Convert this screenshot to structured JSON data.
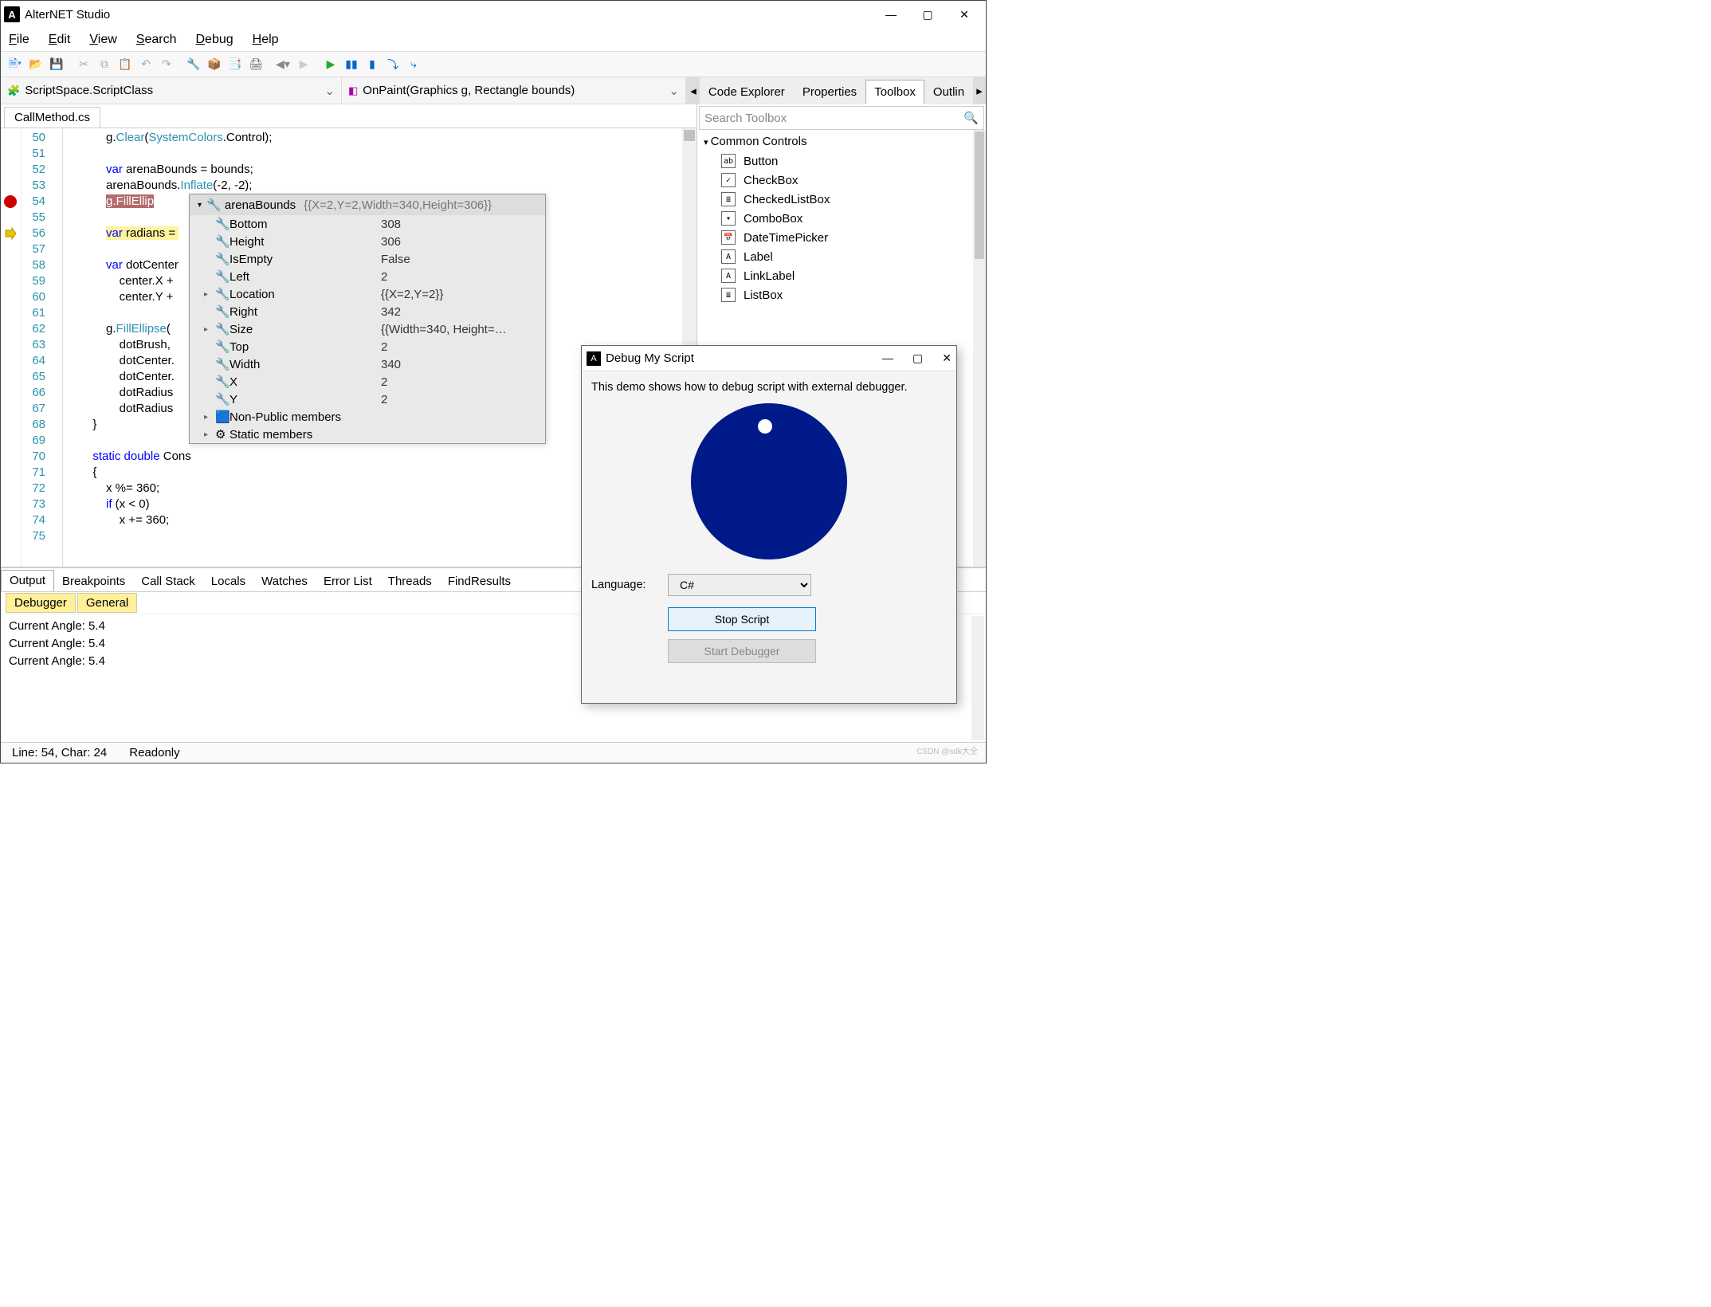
{
  "window": {
    "title": "AlterNET Studio"
  },
  "menu": [
    "File",
    "Edit",
    "View",
    "Search",
    "Debug",
    "Help"
  ],
  "context": {
    "left": "ScriptSpace.ScriptClass",
    "right": "OnPaint(Graphics  g, Rectangle  bounds)"
  },
  "right_tabs": [
    "Code Explorer",
    "Properties",
    "Toolbox",
    "Outlin"
  ],
  "right_tabs_active": 2,
  "file_tab": "CallMethod.cs",
  "editor": {
    "first_line": 50,
    "breakpoint_line": 54,
    "current_line": 56,
    "lines": [
      "            g.Clear(SystemColors.Control);",
      "",
      "            var arenaBounds = bounds;",
      "            arenaBounds.Inflate(-2, -2);",
      "            g.FillEllip",
      "",
      "            var radians = ",
      "",
      "            var dotCenter ",
      "                center.X +",
      "                center.Y +",
      "",
      "            g.FillEllipse(",
      "                dotBrush,",
      "                dotCenter.",
      "                dotCenter.",
      "                dotRadius ",
      "                dotRadius ",
      "        }",
      "",
      "        static double Cons",
      "        {",
      "            x %= 360;",
      "            if (x < 0)",
      "                x += 360;",
      ""
    ]
  },
  "tooltip": {
    "var": "arenaBounds",
    "summary": "{{X=2,Y=2,Width=340,Height=306}}",
    "rows": [
      {
        "exp": "",
        "name": "Bottom",
        "value": "308"
      },
      {
        "exp": "",
        "name": "Height",
        "value": "306"
      },
      {
        "exp": "",
        "name": "IsEmpty",
        "value": "False"
      },
      {
        "exp": "",
        "name": "Left",
        "value": "2"
      },
      {
        "exp": "▸",
        "name": "Location",
        "value": "{{X=2,Y=2}}"
      },
      {
        "exp": "",
        "name": "Right",
        "value": "342"
      },
      {
        "exp": "▸",
        "name": "Size",
        "value": "{{Width=340, Height=…"
      },
      {
        "exp": "",
        "name": "Top",
        "value": "2"
      },
      {
        "exp": "",
        "name": "Width",
        "value": "340"
      },
      {
        "exp": "",
        "name": "X",
        "value": "2"
      },
      {
        "exp": "",
        "name": "Y",
        "value": "2"
      },
      {
        "exp": "▸",
        "name": "Non-Public members",
        "value": "",
        "icon": "cube"
      },
      {
        "exp": "▸",
        "name": "Static members",
        "value": "",
        "icon": "gear"
      }
    ]
  },
  "toolbox": {
    "search_placeholder": "Search Toolbox",
    "group": "Common Controls",
    "items": [
      {
        "icon": "ab",
        "label": "Button"
      },
      {
        "icon": "✓",
        "label": "CheckBox"
      },
      {
        "icon": "≣",
        "label": "CheckedListBox"
      },
      {
        "icon": "▾",
        "label": "ComboBox"
      },
      {
        "icon": "📅",
        "label": "DateTimePicker"
      },
      {
        "icon": "A",
        "label": "Label"
      },
      {
        "icon": "A",
        "label": "LinkLabel"
      },
      {
        "icon": "≣",
        "label": "ListBox"
      }
    ]
  },
  "bottom": {
    "tabs": [
      "Output",
      "Breakpoints",
      "Call Stack",
      "Locals",
      "Watches",
      "Error List",
      "Threads",
      "FindResults"
    ],
    "active": 0,
    "subtabs": [
      "Debugger",
      "General"
    ],
    "lines": [
      "Current Angle: 5.4",
      "Current Angle: 5.4",
      "Current Angle: 5.4"
    ]
  },
  "status": {
    "pos": "Line: 54, Char: 24",
    "mode": "Readonly"
  },
  "debug_window": {
    "title": "Debug My Script",
    "desc": "This demo shows how to debug script with external debugger.",
    "lang_label": "Language:",
    "lang_value": "C#",
    "stop": "Stop Script",
    "start": "Start Debugger"
  },
  "watermark": "CSDN @sdk大全"
}
